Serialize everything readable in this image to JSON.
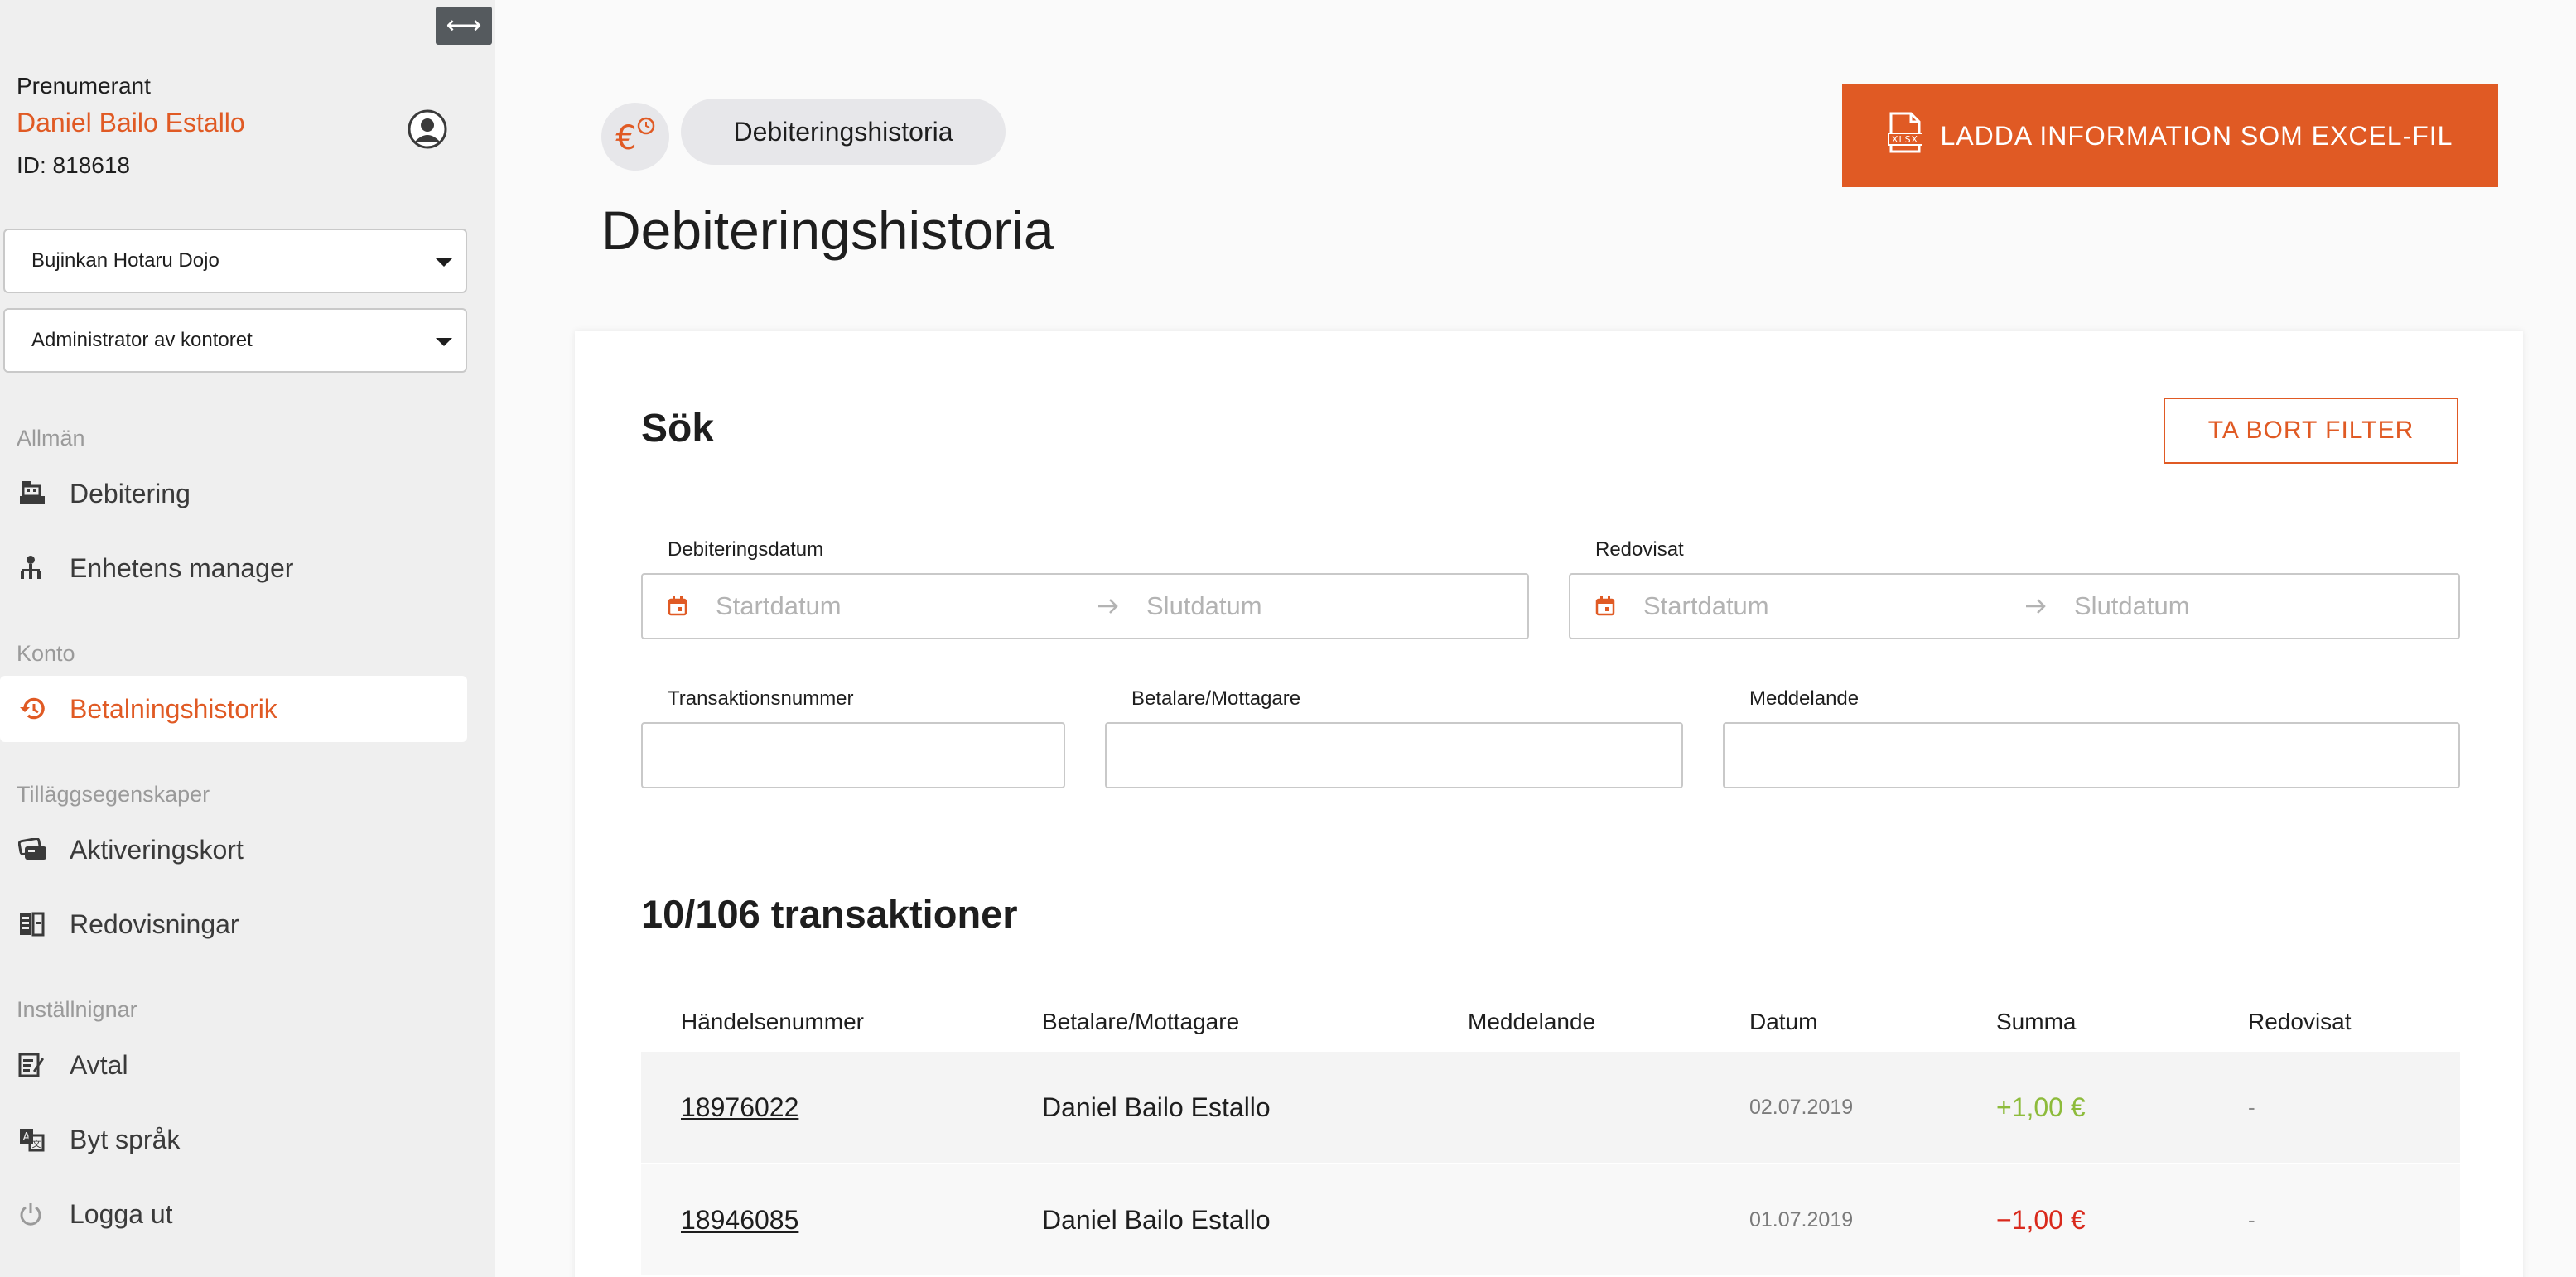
{
  "sidebar": {
    "collapse_icon": "⟷",
    "subscriber_label": "Prenumerant",
    "subscriber_name": "Daniel Bailo Estallo",
    "subscriber_id": "ID: 818618",
    "org_select": "Bujinkan Hotaru Dojo",
    "role_select": "Administrator av kontoret",
    "sections": [
      {
        "label": "Allmän",
        "items": [
          {
            "label": "Debitering",
            "icon": "cash-register-icon"
          },
          {
            "label": "Enhetens manager",
            "icon": "hierarchy-icon"
          }
        ]
      },
      {
        "label": "Konto",
        "items": [
          {
            "label": "Betalningshistorik",
            "icon": "history-icon",
            "active": true
          }
        ]
      },
      {
        "label": "Tilläggsegenskaper",
        "items": [
          {
            "label": "Aktiveringskort",
            "icon": "cards-icon"
          },
          {
            "label": "Redovisningar",
            "icon": "ledger-icon"
          }
        ]
      },
      {
        "label": "Inställnignar",
        "items": [
          {
            "label": "Avtal",
            "icon": "contract-icon"
          },
          {
            "label": "Byt språk",
            "icon": "translate-icon"
          },
          {
            "label": "Logga ut",
            "icon": "power-icon"
          }
        ]
      }
    ]
  },
  "header": {
    "breadcrumb": "Debiteringshistoria",
    "title": "Debiteringshistoria",
    "excel_button": "LADDA INFORMATION SOM EXCEL-FIL"
  },
  "search": {
    "title": "Sök",
    "clear_button": "TA BORT FILTER",
    "billing_date_label": "Debiteringsdatum",
    "reported_label": "Redovisat",
    "start_placeholder": "Startdatum",
    "end_placeholder": "Slutdatum",
    "transaction_label": "Transaktionsnummer",
    "payer_label": "Betalare/Mottagare",
    "message_label": "Meddelande"
  },
  "transactions": {
    "count_text": "10/106 transaktioner",
    "columns": [
      "Händelsenummer",
      "Betalare/Mottagare",
      "Meddelande",
      "Datum",
      "Summa",
      "Redovisat"
    ],
    "rows": [
      {
        "number": "18976022",
        "payer": "Daniel Bailo Estallo",
        "message": "",
        "date": "02.07.2019",
        "amount": "+1,00 €",
        "reported": "-"
      },
      {
        "number": "18946085",
        "payer": "Daniel Bailo Estallo",
        "message": "",
        "date": "01.07.2019",
        "amount": "−1,00 €",
        "reported": "-"
      }
    ]
  },
  "colors": {
    "accent": "#e05a24",
    "positive": "#8dbb3b",
    "negative": "#d9291c"
  }
}
